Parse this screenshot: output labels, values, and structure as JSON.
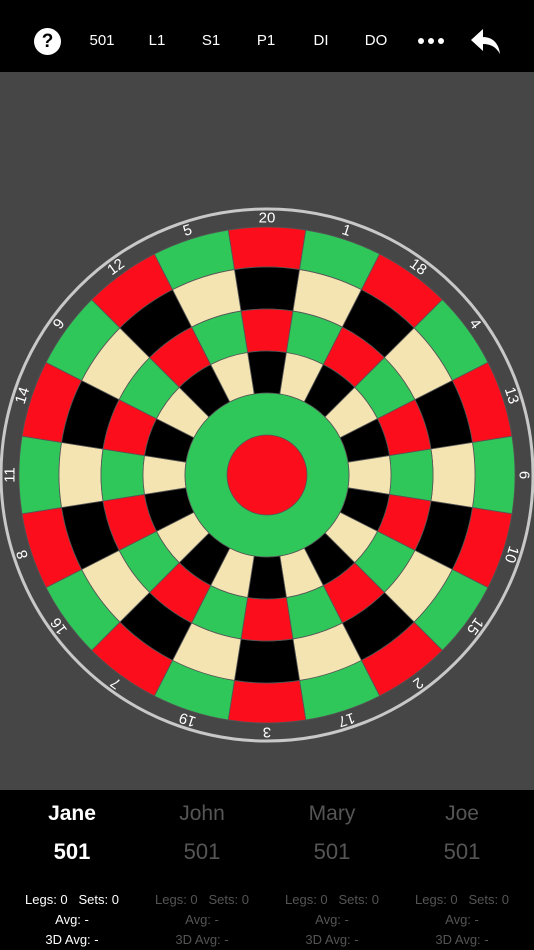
{
  "toolbar": {
    "help_label": "?",
    "items": [
      "501",
      "L1",
      "S1",
      "P1",
      "DI",
      "DO"
    ],
    "more_icon": "ellipsis-icon",
    "undo_icon": "undo-arrow-icon"
  },
  "board": {
    "numbers": [
      "20",
      "1",
      "18",
      "4",
      "13",
      "6",
      "10",
      "15",
      "2",
      "17",
      "3",
      "19",
      "7",
      "16",
      "8",
      "11",
      "14",
      "9",
      "12",
      "5"
    ],
    "colors": {
      "red": "#fc0d1b",
      "green": "#2fc75a",
      "black": "#000000",
      "cream": "#f3e4b2",
      "background": "#464646",
      "wire": "#c8c8c8"
    }
  },
  "players": [
    {
      "name": "Jane",
      "score": "501",
      "legs": "Legs: 0",
      "sets": "Sets: 0",
      "avg": "Avg: -",
      "avg3d": "3D Avg: -",
      "active": true
    },
    {
      "name": "John",
      "score": "501",
      "legs": "Legs: 0",
      "sets": "Sets: 0",
      "avg": "Avg: -",
      "avg3d": "3D Avg: -",
      "active": false
    },
    {
      "name": "Mary",
      "score": "501",
      "legs": "Legs: 0",
      "sets": "Sets: 0",
      "avg": "Avg: -",
      "avg3d": "3D Avg: -",
      "active": false
    },
    {
      "name": "Joe",
      "score": "501",
      "legs": "Legs: 0",
      "sets": "Sets: 0",
      "avg": "Avg: -",
      "avg3d": "3D Avg: -",
      "active": false
    }
  ]
}
